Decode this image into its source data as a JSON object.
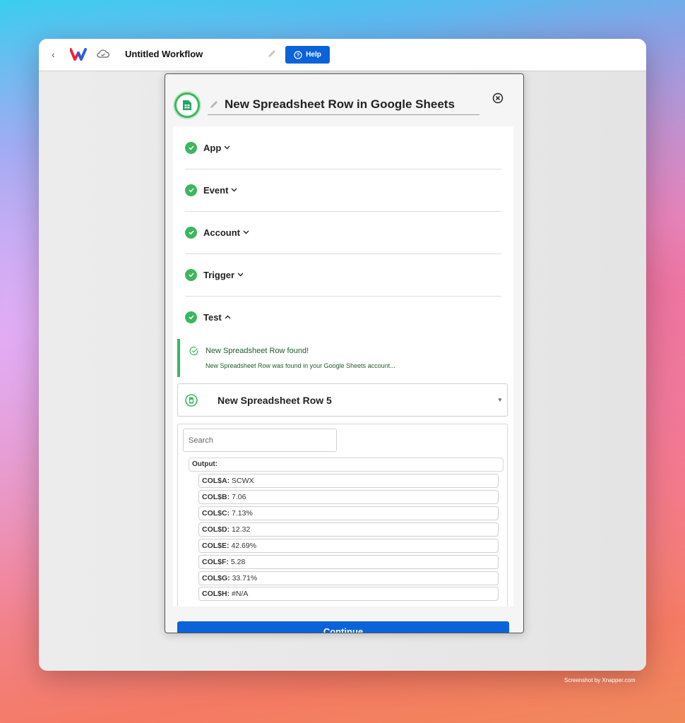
{
  "topbar": {
    "workflow_title": "Untitled Workflow",
    "help_label": "Help"
  },
  "panel": {
    "title": "New Spreadsheet Row in Google Sheets",
    "sections": [
      {
        "label": "App",
        "chevron": "⌄"
      },
      {
        "label": "Event",
        "chevron": "⌄"
      },
      {
        "label": "Account",
        "chevron": "⌄"
      },
      {
        "label": "Trigger",
        "chevron": "⌄"
      },
      {
        "label": "Test",
        "chevron": "^"
      }
    ],
    "alert": {
      "title": "New Spreadsheet Row found!",
      "message": "New Spreadsheet Row was found in your Google Sheets account..."
    },
    "row_select": {
      "label": "New Spreadsheet Row 5"
    },
    "search": {
      "placeholder": "Search"
    },
    "output": {
      "header": "Output:",
      "rows": [
        {
          "key": "COL$A:",
          "value": "SCWX"
        },
        {
          "key": "COL$B:",
          "value": "7.06"
        },
        {
          "key": "COL$C:",
          "value": "7.13%"
        },
        {
          "key": "COL$D:",
          "value": "12.32"
        },
        {
          "key": "COL$E:",
          "value": "42.69%"
        },
        {
          "key": "COL$F:",
          "value": "5.28"
        },
        {
          "key": "COL$G:",
          "value": "33.71%"
        },
        {
          "key": "COL$H:",
          "value": "#N/A"
        }
      ]
    },
    "continue_label": "Continue"
  },
  "credit": "Screenshot by Xnapper.com",
  "colors": {
    "accent_blue": "#0b63d9",
    "success_green": "#3bb75e"
  },
  "icons": [
    "back-chevron-icon",
    "app-logo-icon",
    "cloud-icon",
    "pencil-icon",
    "help-circle-icon",
    "google-sheets-icon",
    "close-circle-icon",
    "check-circle-icon",
    "caret-down-icon"
  ]
}
